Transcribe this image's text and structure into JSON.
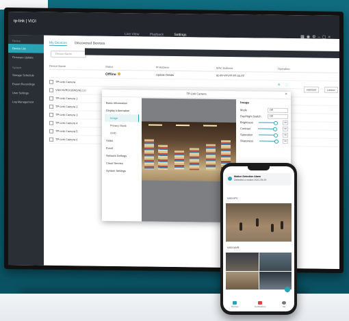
{
  "app": {
    "logo": "tp-link | VIGI"
  },
  "topnav": [
    "Live View",
    "Playback",
    "Settings"
  ],
  "sidebar": {
    "device_head": "Device",
    "items": [
      "Device List",
      "Firmware Update"
    ],
    "system_head": "System",
    "system_items": [
      "Storage Schedule",
      "Export Recordings",
      "User Settings",
      "Log Management"
    ]
  },
  "tabs": {
    "my_devices": "My Devices",
    "discovered": "Discovered Devices"
  },
  "search_placeholder": "Device Name",
  "buttons": {
    "refresh": "Refresh",
    "delete": "Delete"
  },
  "table": {
    "headers": [
      "Device Name",
      "Status",
      "IP Address",
      "MAC Address",
      "Operation"
    ],
    "offline_label": "Offline",
    "offline_ip": "Update Details",
    "offline_mac": "00-FF-FF-FF-FF-00-FF",
    "rows": [
      "TP-Link Camera",
      "VIGI NVR1016H(UN) 1.0",
      "TP-Link Camera 1",
      "TP-Link Camera 2",
      "TP-Link Camera 3",
      "TP-Link Camera 4",
      "TP-Link Camera 5",
      "TP-Link Camera 6"
    ]
  },
  "modal": {
    "title": "TP-Link Camera",
    "menu": [
      "Basic Information",
      "Display Information",
      "Image",
      "Privacy Mask",
      "OSD",
      "Video",
      "Event",
      "Network Settings",
      "Cloud Service",
      "System Settings"
    ],
    "image_panel": {
      "header": "Image",
      "mode_label": "Mode",
      "mode_value": "Off",
      "daynight_label": "Day/Night Switch",
      "daynight_value": "Off",
      "brightness_label": "Brightness",
      "brightness_value": "50",
      "contrast_label": "Contrast",
      "contrast_value": "50",
      "saturation_label": "Saturation",
      "saturation_value": "50",
      "sharpness_label": "Sharpness",
      "sharpness_value": "50"
    }
  },
  "phone": {
    "notif_title": "Motion Detection Alarm",
    "notif_sub": "Detected a motion 2022-05-09",
    "section1": "VIGI IPC",
    "section2": "VIGI NVR",
    "tabs": [
      "Devices",
      "Notifications",
      "Me"
    ]
  }
}
